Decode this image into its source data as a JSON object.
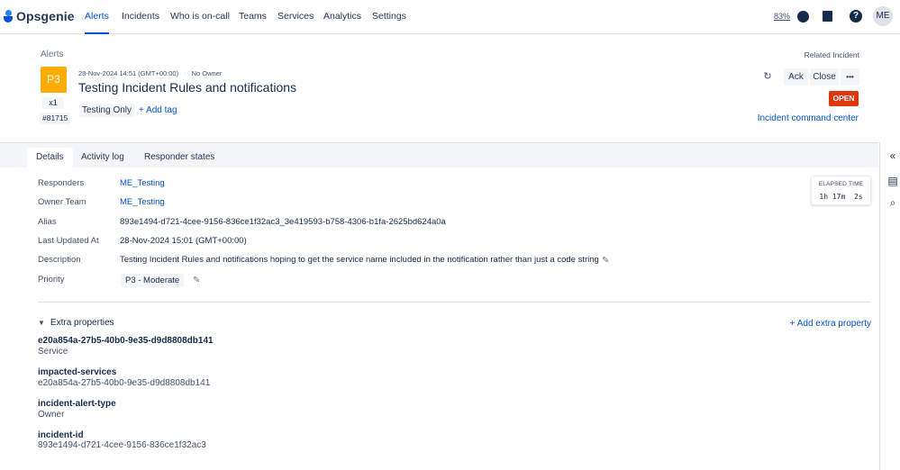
{
  "app": {
    "name": "Opsgenie"
  },
  "nav": {
    "items": [
      {
        "label": "Alerts",
        "active": true
      },
      {
        "label": "Incidents"
      },
      {
        "label": "Who is on-call"
      },
      {
        "label": "Teams"
      },
      {
        "label": "Services"
      },
      {
        "label": "Analytics"
      },
      {
        "label": "Settings"
      }
    ],
    "zoom": "83%",
    "avatar_initials": "ME"
  },
  "header": {
    "breadcrumb": "Alerts",
    "priority": "P3",
    "count": "x1",
    "alert_id": "#81715",
    "created": "28-Nov-2024 14:51 (GMT+00:00)",
    "separator": "·",
    "owner": "No Owner",
    "title": "Testing Incident Rules and notifications",
    "tag": "Testing Only",
    "add_tag": "+ Add tag",
    "related_label": "Related Incident",
    "ack_label": "Ack",
    "close_label": "Close",
    "more_label": "•••",
    "status": "OPEN",
    "command_center": "Incident command center"
  },
  "tabs": [
    {
      "label": "Details",
      "active": true
    },
    {
      "label": "Activity log"
    },
    {
      "label": "Responder states"
    }
  ],
  "details": {
    "rows": [
      {
        "label": "Responders",
        "value": "ME_Testing",
        "link": true
      },
      {
        "label": "Owner Team",
        "value": "ME_Testing",
        "link": true
      },
      {
        "label": "Alias",
        "value": "893e1494-d721-4cee-9156-836ce1f32ac3_3e419593-b758-4306-b1fa-2625bd624a0a"
      },
      {
        "label": "Last Updated At",
        "value": "28-Nov-2024 15:01 (GMT+00:00)"
      },
      {
        "label": "Description",
        "value": "Testing Incident Rules and notifications hoping to get the service name included in the notification rather than just a code string"
      },
      {
        "label": "Priority",
        "value": "P3 - Moderate"
      }
    ],
    "elapsed_label": "ELAPSED TIME",
    "elapsed_value": "1h 17m  2s"
  },
  "extra": {
    "heading": "Extra properties",
    "add_label": "+ Add extra property",
    "properties": [
      {
        "key": "e20a854a-27b5-40b0-9e35-d9d8808db141",
        "value": "Service"
      },
      {
        "key": "impacted-services",
        "value": "e20a854a-27b5-40b0-9e35-d9d8808db141"
      },
      {
        "key": "incident-alert-type",
        "value": "Owner"
      },
      {
        "key": "incident-id",
        "value": "893e1494-d721-4cee-9156-836ce1f32ac3"
      }
    ]
  },
  "colors": {
    "brand": "#0052cc",
    "priority_p3": "#ffab00",
    "status_open": "#de350b"
  },
  "icons": [
    "compass-icon",
    "book-icon",
    "help-icon",
    "refresh-icon",
    "collapse-icon",
    "notes-icon",
    "attachment-icon",
    "pencil-icon",
    "chevron-down-icon"
  ]
}
